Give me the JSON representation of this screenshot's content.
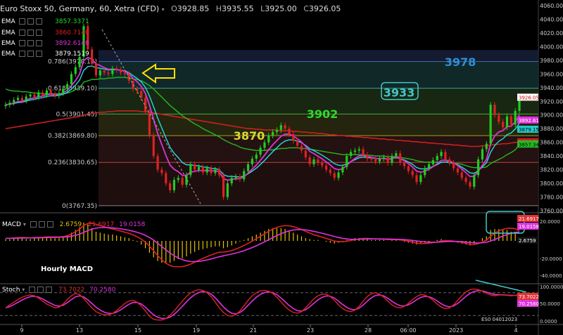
{
  "header": {
    "symbol": "Euro Stoxx 50, Germany, 60, Xetra (CFD)",
    "o_label": "O",
    "o_value": "3928.85",
    "h_label": "H",
    "h_value": "3935.55",
    "l_label": "L",
    "l_value": "3925.00",
    "c_label": "C",
    "c_value": "3926.05"
  },
  "indicators": [
    {
      "name": "EMA",
      "value": "3857.3371",
      "color": "#22dd22"
    },
    {
      "name": "EMA",
      "value": "3860.7140",
      "color": "#dd2222"
    },
    {
      "name": "EMA",
      "value": "3892.6148",
      "color": "#dd33dd"
    },
    {
      "name": "EMA",
      "value": "3879.1519",
      "color": "#22dddd"
    }
  ],
  "fib_levels": [
    {
      "label": "0.786(3978.16)",
      "value": 3978.16,
      "color": "#3a6fb0"
    },
    {
      "label": "0.618(3939.10)",
      "value": 3939.1,
      "color": "#3aa0a0"
    },
    {
      "label": "0.5(3901.45)",
      "value": 3901.45,
      "color": "#44aa44"
    },
    {
      "label": "0.382(3869.80)",
      "value": 3869.8,
      "color": "#a0a020"
    },
    {
      "label": "0.236(3830.65)",
      "value": 3830.65,
      "color": "#c04040"
    },
    {
      "label": "0(3767.35)",
      "value": 3767.35,
      "color": "#888888"
    }
  ],
  "annotations": [
    {
      "text": "3978",
      "value": 3978,
      "x": 654,
      "color": "#2f8fd8"
    },
    {
      "text": "3933",
      "value": 3933,
      "x": 567,
      "color": "#40c8c8",
      "boxed": true
    },
    {
      "text": "3902",
      "value": 3902,
      "x": 458,
      "color": "#30d830"
    },
    {
      "text": "3870",
      "value": 3870,
      "x": 354,
      "color": "#d8d830"
    }
  ],
  "price_axis": {
    "ticks": [
      "4060.00",
      "4040.00",
      "4020.00",
      "4000.00",
      "3980.00",
      "3960.00",
      "3940.00",
      "3920.00",
      "3900.00",
      "3880.00",
      "3860.00",
      "3840.00",
      "3820.00",
      "3800.00",
      "3780.00",
      "3760.00"
    ],
    "min": 3760,
    "max": 4060
  },
  "price_tags": [
    {
      "text": "3926.05",
      "value": 3926.05,
      "bg": "#ffffff",
      "fg": "#cc0000"
    },
    {
      "text": "3892.61",
      "value": 3892.61,
      "bg": "#dd33dd",
      "fg": "#ffffff"
    },
    {
      "text": "3879.15",
      "value": 3879.15,
      "bg": "#22cccc",
      "fg": "#000000"
    },
    {
      "text": "3860.71",
      "value": 3860.71,
      "bg": "#cc2222",
      "fg": "#ffffff"
    },
    {
      "text": "3857.34",
      "value": 3857.34,
      "bg": "#22bb22",
      "fg": "#000000"
    }
  ],
  "x_axis": [
    "9",
    "13",
    "15",
    "19",
    "21",
    "23",
    "28",
    "06:00",
    "2023",
    "4"
  ],
  "macd": {
    "label": "MACD",
    "value1": "2.6759",
    "value2": "21.6917",
    "value3": "19.0158",
    "note": "Hourly MACD",
    "ticks": [
      "20.0000",
      "-20.0000",
      "-40.0000"
    ],
    "tags": [
      {
        "text": "21.6917",
        "bg": "#dd3333"
      },
      {
        "text": "19.0158",
        "bg": "#dd33dd"
      },
      {
        "text": "2.6759",
        "bg": "#111111"
      }
    ]
  },
  "stoch": {
    "label": "Stoch",
    "value1": "73.7022",
    "value2": "70.2580",
    "watermark": "ES0 04012023",
    "ticks": [
      "100.0000",
      "50.0000",
      "0.0000"
    ],
    "tags": [
      {
        "text": "73.7022",
        "bg": "#dd3333"
      },
      {
        "text": "70.2580",
        "bg": "#dd33dd"
      }
    ]
  },
  "chart_data": {
    "type": "candlestick",
    "title": "Euro Stoxx 50, Germany, 60, Xetra (CFD)",
    "ylim": [
      3760,
      4060
    ],
    "close": [
      3915,
      3918,
      3922,
      3925,
      3921,
      3927,
      3930,
      3926,
      3933,
      3929,
      3936,
      3931,
      3928,
      3932,
      3938,
      3945,
      3960,
      3970,
      3985,
      4030,
      3996,
      3975,
      3958,
      3965,
      3962,
      3960,
      3968,
      3966,
      3962,
      3960,
      3950,
      3938,
      3935,
      3925,
      3905,
      3870,
      3840,
      3820,
      3815,
      3800,
      3790,
      3805,
      3808,
      3798,
      3812,
      3828,
      3820,
      3824,
      3816,
      3822,
      3815,
      3820,
      3812,
      3780,
      3800,
      3808,
      3810,
      3806,
      3818,
      3828,
      3836,
      3842,
      3852,
      3860,
      3870,
      3875,
      3878,
      3885,
      3880,
      3872,
      3862,
      3855,
      3848,
      3838,
      3828,
      3835,
      3830,
      3826,
      3820,
      3815,
      3808,
      3816,
      3824,
      3840,
      3846,
      3848,
      3850,
      3842,
      3836,
      3835,
      3832,
      3836,
      3838,
      3830,
      3840,
      3844,
      3830,
      3825,
      3818,
      3812,
      3802,
      3812,
      3822,
      3828,
      3834,
      3840,
      3846,
      3835,
      3830,
      3822,
      3816,
      3808,
      3802,
      3795,
      3812,
      3835,
      3850,
      3858,
      3915,
      3900,
      3890,
      3882,
      3898,
      3886,
      3906,
      3926
    ],
    "ema_green": [
      3938,
      3936,
      3935,
      3935,
      3934,
      3934,
      3933,
      3932,
      3932,
      3931,
      3931,
      3931,
      3931,
      3931,
      3931,
      3932,
      3934,
      3937,
      3940,
      3948,
      3950,
      3952,
      3952,
      3953,
      3953,
      3954,
      3954,
      3955,
      3955,
      3955,
      3954,
      3953,
      3952,
      3950,
      3947,
      3943,
      3938,
      3932,
      3926,
      3920,
      3914,
      3909,
      3904,
      3899,
      3895,
      3891,
      3887,
      3884,
      3880,
      3877,
      3874,
      3871,
      3868,
      3864,
      3861,
      3858,
      3856,
      3853,
      3851,
      3850,
      3849,
      3848,
      3848,
      3848,
      3849,
      3849,
      3850,
      3851,
      3851,
      3852,
      3852,
      3852,
      3851,
      3851,
      3850,
      3849,
      3848,
      3847,
      3846,
      3845,
      3844,
      3843,
      3842,
      3842,
      3842,
      3842,
      3842,
      3842,
      3841,
      3841,
      3840,
      3840,
      3840,
      3839,
      3839,
      3839,
      3838,
      3837,
      3836,
      3835,
      3833,
      3832,
      3831,
      3831,
      3831,
      3831,
      3831,
      3831,
      3830,
      3829,
      3829,
      3828,
      3826,
      3824,
      3823,
      3823,
      3823,
      3824,
      3829,
      3832,
      3835,
      3838,
      3842,
      3845,
      3849,
      3857
    ],
    "ema_red": [
      3880,
      3881,
      3882,
      3883,
      3884,
      3885,
      3886,
      3887,
      3888,
      3889,
      3890,
      3891,
      3892,
      3893,
      3894,
      3895,
      3896,
      3897,
      3898,
      3900,
      3901,
      3902,
      3903,
      3904,
      3904,
      3905,
      3905,
      3906,
      3906,
      3906,
      3906,
      3906,
      3906,
      3905,
      3905,
      3904,
      3903,
      3902,
      3901,
      3900,
      3899,
      3898,
      3897,
      3896,
      3895,
      3894,
      3893,
      3892,
      3891,
      3890,
      3889,
      3888,
      3887,
      3886,
      3885,
      3884,
      3883,
      3882,
      3881,
      3880,
      3880,
      3879,
      3879,
      3878,
      3878,
      3878,
      3878,
      3877,
      3877,
      3877,
      3876,
      3876,
      3875,
      3875,
      3874,
      3874,
      3873,
      3873,
      3872,
      3871,
      3871,
      3870,
      3870,
      3869,
      3869,
      3868,
      3868,
      3867,
      3867,
      3866,
      3866,
      3865,
      3865,
      3864,
      3864,
      3863,
      3863,
      3862,
      3862,
      3861,
      3861,
      3860,
      3860,
      3859,
      3859,
      3858,
      3858,
      3857,
      3857,
      3856,
      3856,
      3855,
      3855,
      3854,
      3854,
      3854,
      3855,
      3855,
      3856,
      3857,
      3857,
      3858,
      3858,
      3859,
      3860,
      3860
    ],
    "macd_hist": [
      2,
      2,
      3,
      3,
      3,
      2,
      2,
      3,
      3,
      3,
      4,
      3,
      3,
      3,
      4,
      6,
      9,
      12,
      15,
      20,
      18,
      14,
      10,
      9,
      8,
      7,
      7,
      6,
      5,
      4,
      3,
      1,
      -1,
      -4,
      -8,
      -13,
      -18,
      -22,
      -24,
      -25,
      -24,
      -22,
      -20,
      -19,
      -17,
      -14,
      -12,
      -10,
      -9,
      -8,
      -7,
      -6,
      -6,
      -8,
      -7,
      -5,
      -3,
      -1,
      1,
      3,
      5,
      7,
      9,
      11,
      13,
      14,
      14,
      14,
      13,
      11,
      9,
      7,
      5,
      3,
      2,
      1,
      1,
      0,
      -1,
      -2,
      -3,
      -2,
      -1,
      1,
      2,
      3,
      3,
      3,
      2,
      1,
      1,
      1,
      1,
      0,
      1,
      1,
      0,
      -1,
      -2,
      -3,
      -4,
      -3,
      -2,
      -1,
      0,
      1,
      2,
      1,
      0,
      -1,
      -2,
      -3,
      -4,
      -5,
      -3,
      0,
      3,
      5,
      12,
      13,
      13,
      12,
      12,
      10,
      8,
      3
    ],
    "stoch_k": [
      40,
      48,
      55,
      62,
      68,
      72,
      74,
      72,
      66,
      58,
      50,
      45,
      40,
      42,
      50,
      62,
      72,
      78,
      75,
      65,
      52,
      40,
      30,
      25,
      22,
      22,
      25,
      33,
      42,
      52,
      58,
      60,
      55,
      45,
      32,
      18,
      10,
      8,
      8,
      12,
      20,
      32,
      45,
      58,
      70,
      80,
      85,
      88,
      86,
      80,
      70,
      55,
      40,
      28,
      20,
      18,
      22,
      32,
      46,
      60,
      72,
      80,
      85,
      86,
      84,
      78,
      68,
      56,
      44,
      34,
      28,
      26,
      30,
      40,
      52,
      64,
      72,
      76,
      76,
      70,
      60,
      48,
      38,
      32,
      30,
      34,
      44,
      58,
      70,
      78,
      80,
      76,
      68,
      58,
      48,
      42,
      40,
      44,
      52,
      62,
      70,
      75,
      74,
      68,
      60,
      50,
      42,
      38,
      40,
      48,
      60,
      72,
      82,
      88,
      90,
      88,
      84,
      78,
      74,
      72,
      74,
      74,
      73,
      72,
      73,
      74
    ]
  }
}
